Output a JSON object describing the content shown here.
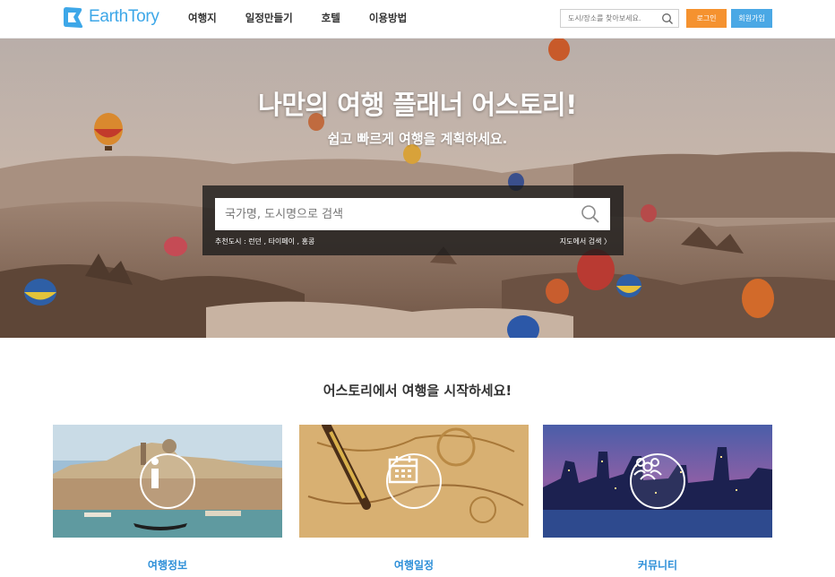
{
  "header": {
    "logo_text": "EarthTory",
    "nav": [
      "여행지",
      "일정만들기",
      "호텔",
      "이용방법"
    ],
    "search_placeholder": "도시/장소를 찾아보세요.",
    "login_label": "로그인",
    "join_label": "회원가입"
  },
  "hero": {
    "title": "나만의 여행 플래너 어스토리!",
    "subtitle": "쉽고 빠르게 여행을 계획하세요.",
    "search_placeholder": "국가명, 도시명으로 검색",
    "recommended": "추천도시 : 런던 , 타이페이 , 홍콩",
    "map_search": "지도에서 검색 〉"
  },
  "section": {
    "title": "어스토리에서 여행을 시작하세요!",
    "cards": [
      {
        "label": "여행정보",
        "icon": "info-icon"
      },
      {
        "label": "여행일정",
        "icon": "calendar-icon"
      },
      {
        "label": "커뮤니티",
        "icon": "community-icon"
      }
    ]
  },
  "colors": {
    "brand_blue": "#3da7e8",
    "login_orange": "#f5922f",
    "join_blue": "#4aa8e5",
    "card_label_blue": "#2d8fd8"
  }
}
